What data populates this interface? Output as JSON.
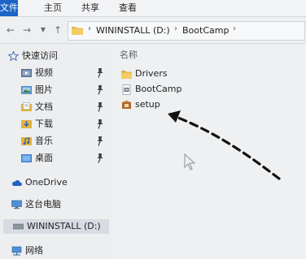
{
  "ribbon": {
    "tabs": [
      {
        "label": "文件"
      },
      {
        "label": "主页"
      },
      {
        "label": "共享"
      },
      {
        "label": "查看"
      }
    ]
  },
  "address_bar": {
    "segments": [
      "WININSTALL (D:)",
      "BootCamp"
    ]
  },
  "navigation": {
    "quick_access": {
      "label": "快速访问",
      "icon": "star-icon"
    },
    "pinned": [
      {
        "label": "视频",
        "icon": "video-folder-icon"
      },
      {
        "label": "图片",
        "icon": "pictures-folder-icon"
      },
      {
        "label": "文档",
        "icon": "documents-folder-icon"
      },
      {
        "label": "下载",
        "icon": "downloads-folder-icon"
      },
      {
        "label": "音乐",
        "icon": "music-folder-icon"
      },
      {
        "label": "桌面",
        "icon": "desktop-folder-icon"
      }
    ],
    "onedrive": {
      "label": "OneDrive",
      "icon": "cloud-icon"
    },
    "this_pc": {
      "label": "这台电脑",
      "icon": "computer-icon"
    },
    "drive": {
      "label": "WININSTALL (D:)",
      "icon": "drive-icon"
    },
    "network": {
      "label": "网络",
      "icon": "network-icon"
    }
  },
  "content": {
    "column_header": "名称",
    "files": [
      {
        "name": "Drivers",
        "icon": "folder-icon"
      },
      {
        "name": "BootCamp",
        "icon": "installer-package-icon"
      },
      {
        "name": "setup",
        "icon": "setup-app-icon"
      }
    ]
  },
  "colors": {
    "accent": "#1c64c8",
    "folder": "#e8b94a",
    "arrow": "#111111"
  }
}
